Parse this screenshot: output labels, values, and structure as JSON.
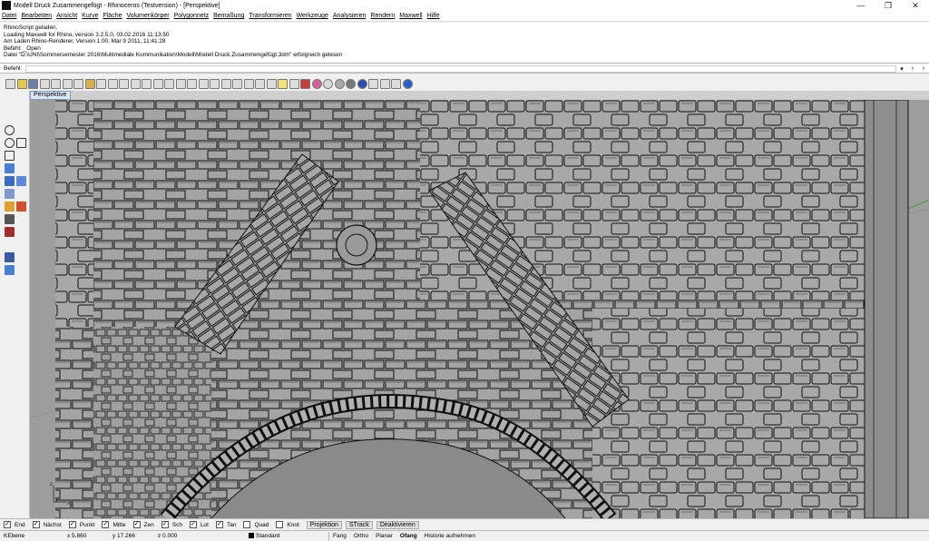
{
  "window": {
    "title": "Modell Druck Zusammengefügt - Rhinoceros (Testversion) - [Perspektive]",
    "minimize": "—",
    "maximize": "❐",
    "close": "✕"
  },
  "menu": [
    "Datei",
    "Bearbeiten",
    "Ansicht",
    "Kurve",
    "Fläche",
    "Volumenkörper",
    "Polygonnetz",
    "Bemaßung",
    "Transformieren",
    "Werkzeuge",
    "Analysieren",
    "Rendern",
    "Maxwell",
    "Hilfe"
  ],
  "command_history": [
    "RhinoScript geladen.",
    "Loading Maxwell for Rhino, version 3.2.5.0, 03.02.2016 11:13:50",
    "Am Laden Rhino-Renderer, Version 1.00, Mar  9 2011, 11:41:28",
    "Befehl: _Open",
    "Datei \"D:\\UNI\\Sommersemester 2016\\Multimediale Kommunikation\\Modell\\Modell Druck Zusammengefügt.3dm\" erfolgreich gelesen"
  ],
  "command_line": {
    "label": "Befehl:",
    "dropdown": "▾",
    "back": "‹",
    "forward": "›"
  },
  "viewport_tab": "Perspektive",
  "axis": {
    "z": "z",
    "y": "y",
    "x": "x"
  },
  "osnaps": [
    {
      "label": "End",
      "checked": true
    },
    {
      "label": "Nächst",
      "checked": true
    },
    {
      "label": "Punkt",
      "checked": true
    },
    {
      "label": "Mitte",
      "checked": true
    },
    {
      "label": "Zen",
      "checked": true
    },
    {
      "label": "Sch",
      "checked": true
    },
    {
      "label": "Lot",
      "checked": true
    },
    {
      "label": "Tan",
      "checked": true
    },
    {
      "label": "Quad",
      "checked": false
    },
    {
      "label": "Knot",
      "checked": false
    }
  ],
  "osnap_buttons": [
    "Projektion",
    "STrack",
    "Deaktivieren"
  ],
  "status": {
    "plane": "KEbene",
    "x": "x 5.860",
    "y": "y 17.266",
    "z": "z 0.000",
    "layer": "Standard",
    "toggles": [
      "Fang",
      "Ortho",
      "Planar",
      "Ofang",
      "Historie aufnehmen"
    ]
  }
}
